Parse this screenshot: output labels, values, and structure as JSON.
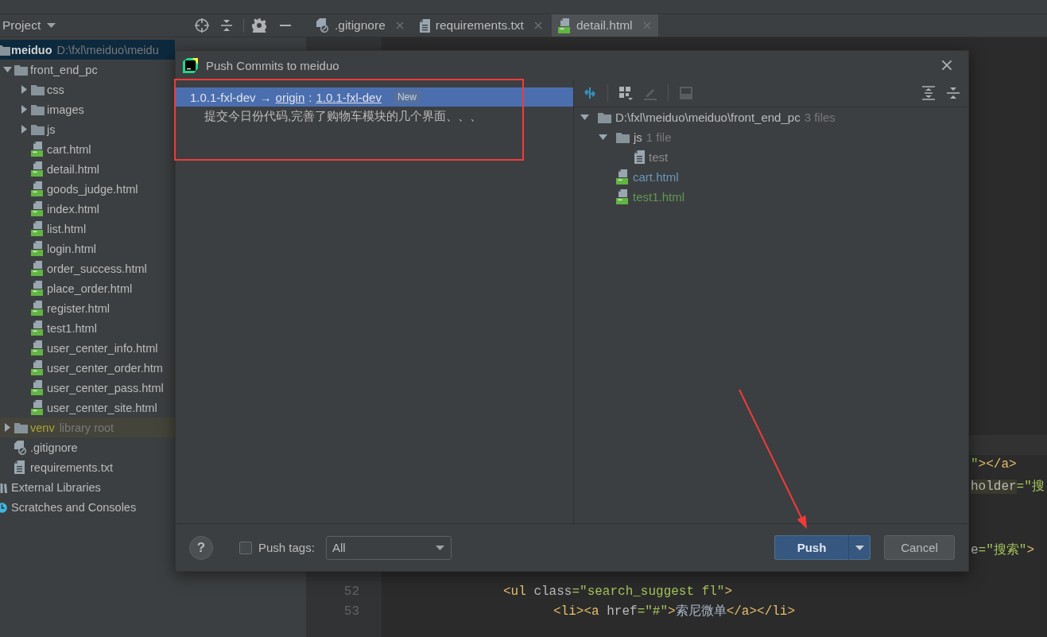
{
  "sidebar": {
    "title": "Project",
    "tree": [
      {
        "label": "meiduo",
        "hint": "D:\\fxl\\meiduo\\meidu",
        "kind": "module",
        "selected": true,
        "children": [
          {
            "label": "front_end_pc",
            "kind": "folder",
            "expanded": true,
            "selected": false,
            "children": [
              {
                "label": "css",
                "kind": "folder",
                "expanded": false,
                "selected": false
              },
              {
                "label": "images",
                "kind": "folder",
                "expanded": false,
                "selected": false
              },
              {
                "label": "js",
                "kind": "folder",
                "expanded": false,
                "selected": false
              },
              {
                "label": "cart.html",
                "kind": "html",
                "selected": false
              },
              {
                "label": "detail.html",
                "kind": "html",
                "selected": false
              },
              {
                "label": "goods_judge.html",
                "kind": "html",
                "selected": false
              },
              {
                "label": "index.html",
                "kind": "html",
                "selected": false
              },
              {
                "label": "list.html",
                "kind": "html",
                "selected": false
              },
              {
                "label": "login.html",
                "kind": "html",
                "selected": false
              },
              {
                "label": "order_success.html",
                "kind": "html",
                "selected": false
              },
              {
                "label": "place_order.html",
                "kind": "html",
                "selected": false
              },
              {
                "label": "register.html",
                "kind": "html",
                "selected": false
              },
              {
                "label": "test1.html",
                "kind": "html",
                "selected": false
              },
              {
                "label": "user_center_info.html",
                "kind": "html",
                "selected": false
              },
              {
                "label": "user_center_order.htm",
                "kind": "html",
                "selected": false
              },
              {
                "label": "user_center_pass.html",
                "kind": "html",
                "selected": false
              },
              {
                "label": "user_center_site.html",
                "kind": "html",
                "selected": false
              }
            ]
          },
          {
            "label": "venv",
            "hint": "library root",
            "kind": "library",
            "expanded": false,
            "selected": false
          },
          {
            "label": ".gitignore",
            "kind": "ignore",
            "selected": false
          },
          {
            "label": "requirements.txt",
            "kind": "text",
            "selected": false
          }
        ]
      },
      {
        "label": "External Libraries",
        "kind": "libraries",
        "selected": false
      },
      {
        "label": "Scratches and Consoles",
        "kind": "scratches",
        "selected": false
      }
    ]
  },
  "editor_tabs": [
    {
      "label": ".gitignore",
      "kind": "ignore",
      "selected": false
    },
    {
      "label": "requirements.txt",
      "kind": "text",
      "selected": false
    },
    {
      "label": "detail.html",
      "kind": "html",
      "selected": true
    }
  ],
  "editor": {
    "side_fragments": [
      {
        "tokens": [
          {
            "kind": "str",
            "text": "\""
          },
          {
            "kind": "tag",
            "text": "></a>"
          }
        ]
      },
      {
        "tokens": [
          {
            "kind": "match",
            "text": "holder"
          },
          {
            "kind": "str",
            "text": "=\"搜"
          }
        ]
      },
      {
        "tokens": [
          {
            "kind": "attr",
            "text": "e"
          },
          {
            "kind": "str",
            "text": "=\"搜索\""
          },
          {
            "kind": "tag",
            "text": ">"
          }
        ]
      }
    ],
    "lines": [
      {
        "number": "52",
        "tokens": [
          {
            "kind": "tag",
            "text": "<ul"
          },
          {
            "kind": "attr",
            "text": " class"
          },
          {
            "kind": "str",
            "text": "=\"search_suggest fl\""
          },
          {
            "kind": "tag",
            "text": ">"
          }
        ],
        "children": [
          {
            "number": "53",
            "tokens": [
              {
                "kind": "tag",
                "text": "<li><a"
              },
              {
                "kind": "attr",
                "text": " href"
              },
              {
                "kind": "str",
                "text": "=\"#\""
              },
              {
                "kind": "tag",
                "text": ">"
              },
              {
                "kind": "text",
                "text": "索尼微单"
              },
              {
                "kind": "tag",
                "text": "</a></li>"
              }
            ]
          }
        ]
      }
    ]
  },
  "dialog": {
    "title": "Push Commits to meiduo",
    "commits": [
      {
        "branch": "1.0.1-fxl-dev",
        "arrow": "→",
        "remote": "origin",
        "separator": ":",
        "target": "1.0.1-fxl-dev",
        "badge": "New",
        "message": "提交今日份代码,完善了购物车模块的几个界面、、、",
        "selected": true
      }
    ],
    "toolbar": [
      {
        "kind": "compare",
        "disabled": false
      },
      {
        "kind": "group",
        "disabled": false
      },
      {
        "kind": "edit",
        "disabled": true
      },
      {
        "kind": "preview",
        "disabled": true
      },
      {
        "kind": "expand",
        "disabled": false
      },
      {
        "kind": "collapse",
        "disabled": false
      }
    ],
    "changes_tree": [
      {
        "label": "D:\\fxl\\meiduo\\meiduo\\front_end_pc",
        "count": "3 files",
        "kind": "folder",
        "expanded": true,
        "children": [
          {
            "label": "js",
            "count": "1 file",
            "kind": "folder",
            "expanded": true,
            "children": [
              {
                "label": "test",
                "kind": "text",
                "color": "#8c8c8c"
              }
            ]
          },
          {
            "label": "cart.html",
            "kind": "html",
            "color": "#6897bb"
          },
          {
            "label": "test1.html",
            "kind": "html",
            "color": "#629755"
          }
        ]
      }
    ],
    "help_label": "?",
    "push_tags": {
      "label": "Push tags:",
      "checked": false
    },
    "tags_dropdown": {
      "value": "All"
    },
    "buttons": [
      {
        "label": "Push",
        "kind": "primary"
      },
      {
        "label": "Cancel",
        "kind": "secondary"
      }
    ]
  }
}
